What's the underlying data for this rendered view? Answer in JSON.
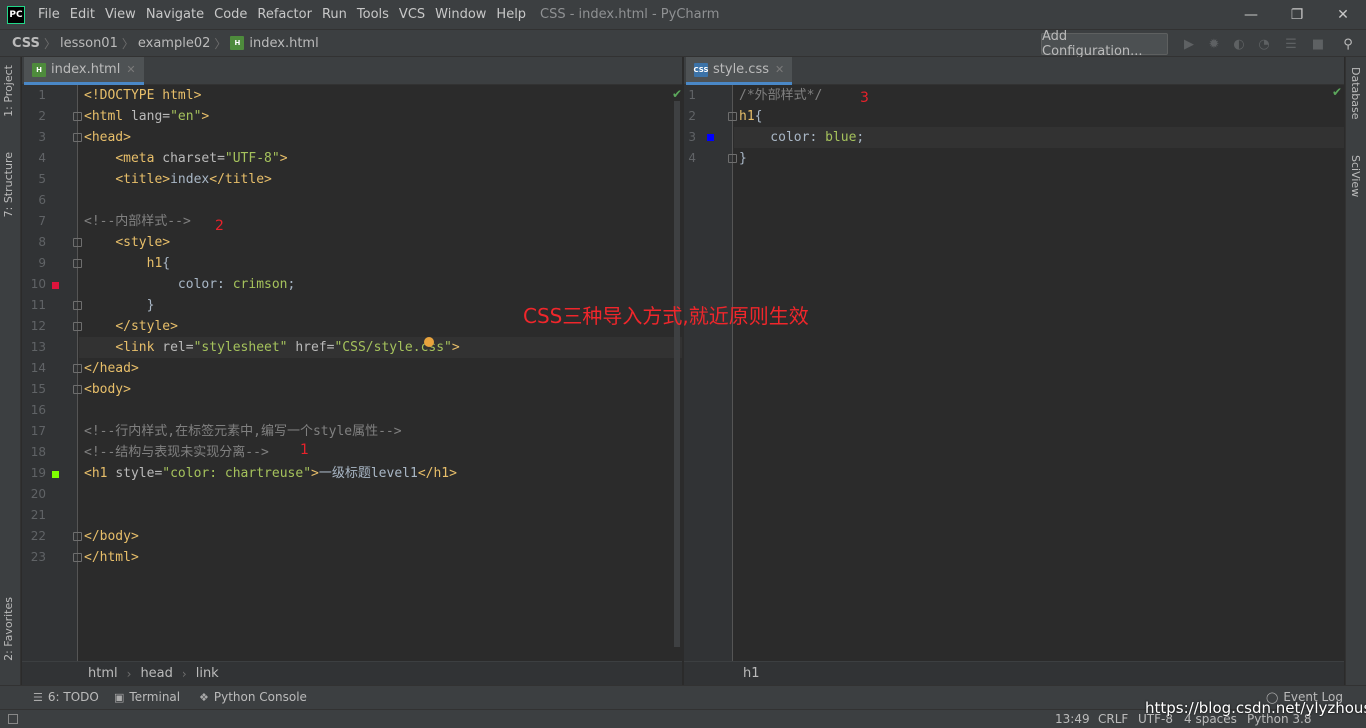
{
  "app": {
    "logo": "PC",
    "window_title": "CSS - index.html - PyCharm",
    "menu": [
      "File",
      "Edit",
      "View",
      "Navigate",
      "Code",
      "Refactor",
      "Run",
      "Tools",
      "VCS",
      "Window",
      "Help"
    ]
  },
  "navbar": {
    "crumbs": [
      "CSS",
      "lesson01",
      "example02",
      "index.html"
    ],
    "add_config": "Add Configuration..."
  },
  "left_tabs": [
    "1: Project",
    "7: Structure",
    "2: Favorites"
  ],
  "right_tabs": [
    "Database",
    "SciView"
  ],
  "left_editor": {
    "tab": "index.html",
    "file_icon": "html-file-icon",
    "lines": [
      [
        [
          "c-doctype",
          "<!DOCTYPE html>"
        ]
      ],
      [
        [
          "c-tag",
          "<html "
        ],
        [
          "c-attr",
          "lang="
        ],
        [
          "c-str",
          "\"en\""
        ],
        [
          "c-tag",
          ">"
        ]
      ],
      [
        [
          "c-tag",
          "<head>"
        ]
      ],
      [
        [
          "c-text",
          "    "
        ],
        [
          "c-tag",
          "<meta "
        ],
        [
          "c-attr",
          "charset="
        ],
        [
          "c-str",
          "\"UTF-8\""
        ],
        [
          "c-tag",
          ">"
        ]
      ],
      [
        [
          "c-text",
          "    "
        ],
        [
          "c-tag",
          "<title>"
        ],
        [
          "c-text",
          "index"
        ],
        [
          "c-tag",
          "</title>"
        ]
      ],
      [],
      [
        [
          "c-comment",
          "<!--内部样式-->"
        ]
      ],
      [
        [
          "c-text",
          "    "
        ],
        [
          "c-tag",
          "<style>"
        ]
      ],
      [
        [
          "c-text",
          "        "
        ],
        [
          "c-sel",
          "h1"
        ],
        [
          "c-text",
          "{"
        ]
      ],
      [
        [
          "c-text",
          "            color: "
        ],
        [
          "c-val",
          "crimson"
        ],
        [
          "c-text",
          ";"
        ]
      ],
      [
        [
          "c-text",
          "        }"
        ]
      ],
      [
        [
          "c-text",
          "    "
        ],
        [
          "c-tag",
          "</style>"
        ]
      ],
      [
        [
          "c-text",
          "    "
        ],
        [
          "c-tag",
          "<link "
        ],
        [
          "c-attr",
          "rel="
        ],
        [
          "c-str",
          "\"stylesheet\" "
        ],
        [
          "c-attr",
          "href="
        ],
        [
          "c-str",
          "\"CSS/style.css\""
        ],
        [
          "c-tag",
          ">"
        ]
      ],
      [
        [
          "c-tag",
          "</head>"
        ]
      ],
      [
        [
          "c-tag",
          "<body>"
        ]
      ],
      [],
      [
        [
          "c-comment",
          "<!--行内样式,在标签元素中,编写一个style属性-->"
        ]
      ],
      [
        [
          "c-comment",
          "<!--结构与表现未实现分离-->"
        ]
      ],
      [
        [
          "c-tag",
          "<h1 "
        ],
        [
          "c-attr",
          "style="
        ],
        [
          "c-str",
          "\"color: "
        ],
        [
          "c-val",
          "chartreuse"
        ],
        [
          "c-str",
          "\""
        ],
        [
          "c-tag",
          ">"
        ],
        [
          "c-text",
          "一级标题level1"
        ],
        [
          "c-tag",
          "</h1>"
        ]
      ],
      [],
      [],
      [
        [
          "c-tag",
          "</body>"
        ]
      ],
      [
        [
          "c-tag",
          "</html>"
        ]
      ]
    ],
    "breadcrumbs": [
      "html",
      "head",
      "link"
    ]
  },
  "right_editor": {
    "tab": "style.css",
    "file_icon": "css-file-icon",
    "lines": [
      [
        [
          "c-comment",
          "/*外部样式*/"
        ]
      ],
      [
        [
          "c-sel",
          "h1"
        ],
        [
          "c-text",
          "{"
        ]
      ],
      [
        [
          "c-text",
          "    color: "
        ],
        [
          "c-val",
          "blue"
        ],
        [
          "c-text",
          ";"
        ]
      ],
      [
        [
          "c-text",
          "}"
        ]
      ]
    ],
    "breadcrumbs": [
      "h1"
    ]
  },
  "annotations": {
    "one": "1",
    "two": "2",
    "three": "3",
    "headline": "CSS三种导入方式,就近原则生效"
  },
  "bottom_tools": [
    "6: TODO",
    "Terminal",
    "Python Console",
    "Event Log"
  ],
  "status": {
    "position": "13:49",
    "line_sep": "CRLF",
    "encoding": "UTF-8",
    "indent": "4 spaces",
    "interpreter": "Python 3.8"
  },
  "watermark": "https://blog.csdn.net/ylyzhousi",
  "colors": {
    "crimson_marker": "#dc143c",
    "chartreuse_marker": "#7fff00",
    "blue_marker": "#0000ff",
    "annotation_red": "#e8222b"
  }
}
